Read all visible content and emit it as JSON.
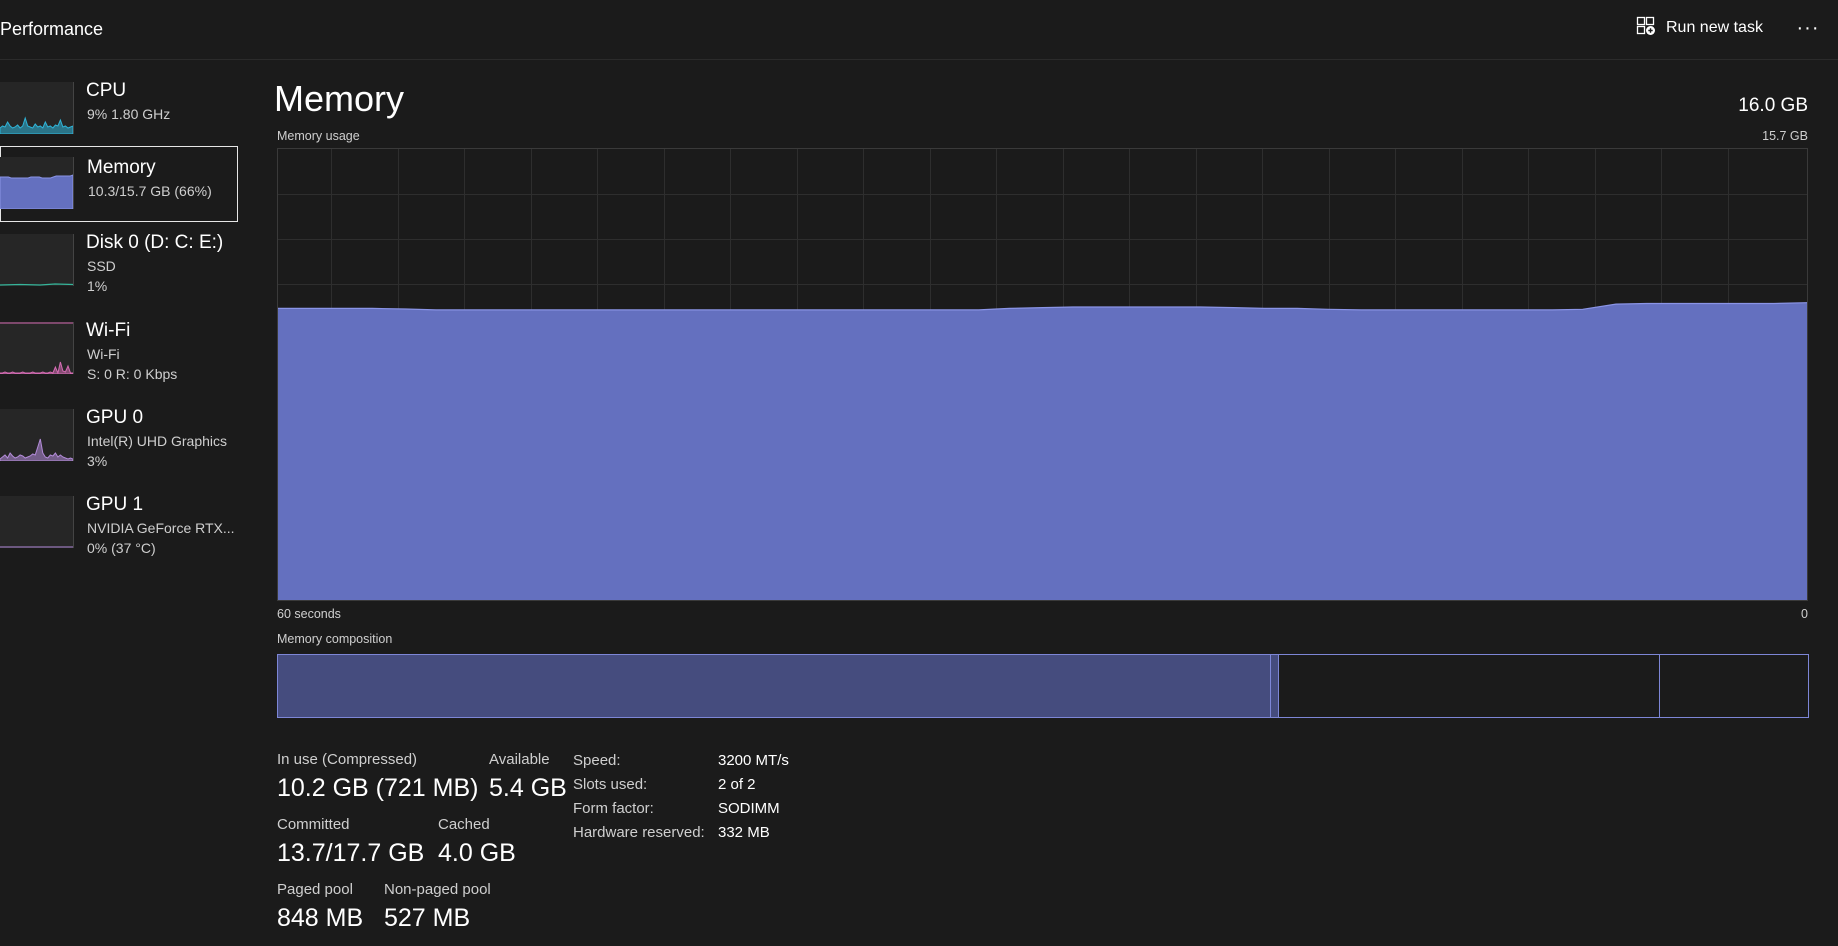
{
  "header": {
    "title": "Performance",
    "run_new_task_label": "Run new task",
    "more_label": "···"
  },
  "colors": {
    "background": "#1b1b1b",
    "memory_fill": "#6470bf",
    "memory_line": "#8a94e6",
    "cpu_line": "#2fb4d8",
    "disk_line": "#36b59a",
    "wifi_line": "#d46bb3",
    "gpu_line": "#b38bd9",
    "composition_in_use": "#454c7e",
    "composition_border": "#7d86d6"
  },
  "sidebar": {
    "items": [
      {
        "name": "CPU",
        "line1": "9%  1.80 GHz",
        "line2": "",
        "icon": "cpu-graph-icon"
      },
      {
        "name": "Memory",
        "line1": "10.3/15.7 GB (66%)",
        "line2": "",
        "icon": "memory-graph-icon"
      },
      {
        "name": "Disk 0 (D: C: E:)",
        "line1": "SSD",
        "line2": "1%",
        "icon": "disk-graph-icon"
      },
      {
        "name": "Wi-Fi",
        "line1": "Wi-Fi",
        "line2": "S: 0  R: 0 Kbps",
        "icon": "wifi-graph-icon"
      },
      {
        "name": "GPU 0",
        "line1": "Intel(R) UHD Graphics",
        "line2": "3%",
        "icon": "gpu0-graph-icon"
      },
      {
        "name": "GPU 1",
        "line1": "NVIDIA GeForce RTX...",
        "line2": "0%  (37 °C)",
        "icon": "gpu1-graph-icon"
      }
    ],
    "selected_index": 1
  },
  "main": {
    "title": "Memory",
    "total_capacity": "16.0 GB",
    "usage_label": "Memory usage",
    "usage_max_label": "15.7 GB",
    "time_span_label": "60 seconds",
    "time_end_label": "0",
    "composition_label": "Memory composition"
  },
  "chart_data": {
    "type": "area",
    "title": "Memory usage",
    "y_unit": "GB",
    "ylim": [
      0,
      15.7
    ],
    "xlim": [
      60,
      0
    ],
    "x": [
      60,
      58.8,
      57.5,
      56.3,
      55,
      53.8,
      52.5,
      51.3,
      50,
      48.8,
      47.5,
      46.3,
      45,
      43.8,
      42.5,
      41.3,
      40,
      38.8,
      37.5,
      36.3,
      35,
      33.8,
      32.5,
      31.3,
      30,
      28.8,
      27.5,
      26.3,
      25,
      23.8,
      22.5,
      21.3,
      20,
      18.8,
      17.5,
      16.3,
      15,
      13.8,
      12.5,
      11.3,
      10,
      8.8,
      7.5,
      6.3,
      5,
      3.8,
      2.5,
      1.3,
      0
    ],
    "values": [
      10.15,
      10.15,
      10.15,
      10.15,
      10.13,
      10.1,
      10.1,
      10.1,
      10.1,
      10.1,
      10.1,
      10.1,
      10.1,
      10.1,
      10.1,
      10.1,
      10.1,
      10.1,
      10.1,
      10.1,
      10.1,
      10.1,
      10.1,
      10.15,
      10.18,
      10.2,
      10.2,
      10.2,
      10.2,
      10.2,
      10.18,
      10.15,
      10.15,
      10.12,
      10.1,
      10.1,
      10.1,
      10.1,
      10.1,
      10.1,
      10.1,
      10.12,
      10.3,
      10.32,
      10.32,
      10.32,
      10.32,
      10.32,
      10.35
    ],
    "grid": true,
    "composition": {
      "in_use_fraction": 0.649,
      "modified_fraction": 0.005,
      "standby_fraction": 0.249,
      "free_fraction": 0.097
    }
  },
  "stats": {
    "in_use_label": "In use (Compressed)",
    "in_use_value": "10.2 GB (721 MB)",
    "available_label": "Available",
    "available_value": "5.4 GB",
    "committed_label": "Committed",
    "committed_value": "13.7/17.7 GB",
    "cached_label": "Cached",
    "cached_value": "4.0 GB",
    "paged_pool_label": "Paged pool",
    "paged_pool_value": "848 MB",
    "non_paged_pool_label": "Non-paged pool",
    "non_paged_pool_value": "527 MB"
  },
  "details": [
    {
      "key": "Speed:",
      "value": "3200 MT/s"
    },
    {
      "key": "Slots used:",
      "value": "2 of 2"
    },
    {
      "key": "Form factor:",
      "value": "SODIMM"
    },
    {
      "key": "Hardware reserved:",
      "value": "332 MB"
    }
  ]
}
